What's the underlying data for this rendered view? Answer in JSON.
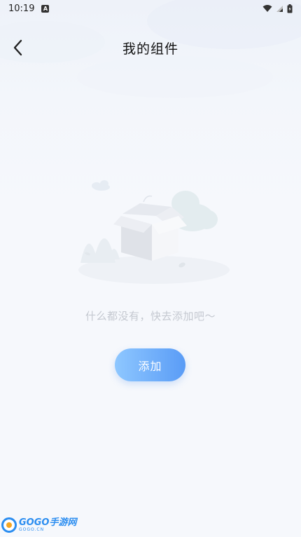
{
  "status_bar": {
    "time": "10:19",
    "notification_glyph": "A",
    "icons": [
      "wifi-icon",
      "cellular-signal-icon",
      "battery-charging-icon"
    ]
  },
  "header": {
    "back_icon": "chevron-left-icon",
    "title": "我的组件"
  },
  "empty_state": {
    "illustration": "empty-box-illustration",
    "message": "什么都没有，快去添加吧～"
  },
  "actions": {
    "add_label": "添加"
  },
  "watermark": {
    "brand": "GOGO",
    "brand_cn": "手游网",
    "domain": "GOGO.CN"
  },
  "colors": {
    "background": "#f6f8fc",
    "button_gradient_start": "#8ec7ff",
    "button_gradient_end": "#5a9cf6",
    "empty_text": "#c4c8d0",
    "title_text": "#111111",
    "watermark_blue": "#2b8df0"
  }
}
